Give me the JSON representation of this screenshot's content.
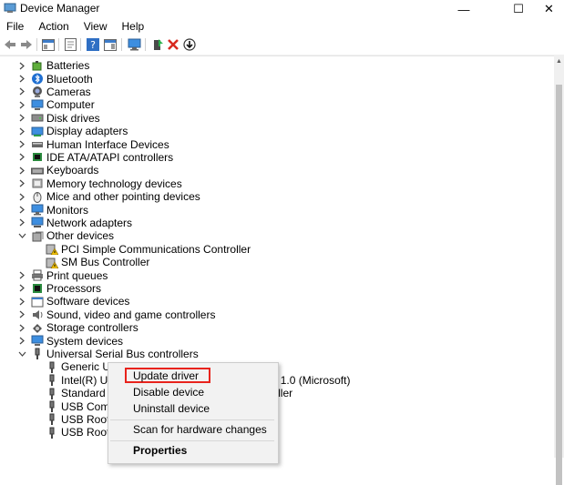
{
  "window": {
    "title": "Device Manager",
    "minimize": "—",
    "maximize": "☐",
    "close": "✕"
  },
  "menu": [
    "File",
    "Action",
    "View",
    "Help"
  ],
  "tree": [
    {
      "label": "Batteries",
      "expanded": false,
      "icon": "battery-icon"
    },
    {
      "label": "Bluetooth",
      "expanded": false,
      "icon": "bluetooth-icon"
    },
    {
      "label": "Cameras",
      "expanded": false,
      "icon": "camera-icon"
    },
    {
      "label": "Computer",
      "expanded": false,
      "icon": "computer-icon"
    },
    {
      "label": "Disk drives",
      "expanded": false,
      "icon": "disk-drive-icon"
    },
    {
      "label": "Display adapters",
      "expanded": false,
      "icon": "display-adapter-icon"
    },
    {
      "label": "Human Interface Devices",
      "expanded": false,
      "icon": "hid-icon"
    },
    {
      "label": "IDE ATA/ATAPI controllers",
      "expanded": false,
      "icon": "ide-controller-icon"
    },
    {
      "label": "Keyboards",
      "expanded": false,
      "icon": "keyboard-icon"
    },
    {
      "label": "Memory technology devices",
      "expanded": false,
      "icon": "memory-icon"
    },
    {
      "label": "Mice and other pointing devices",
      "expanded": false,
      "icon": "mouse-icon"
    },
    {
      "label": "Monitors",
      "expanded": false,
      "icon": "monitor-icon"
    },
    {
      "label": "Network adapters",
      "expanded": false,
      "icon": "network-adapter-icon"
    },
    {
      "label": "Other devices",
      "expanded": true,
      "icon": "other-devices-icon"
    },
    {
      "label": "PCI Simple Communications Controller",
      "child": true,
      "icon": "warning-device-icon"
    },
    {
      "label": "SM Bus Controller",
      "child": true,
      "icon": "warning-device-icon"
    },
    {
      "label": "Print queues",
      "expanded": false,
      "icon": "printer-icon"
    },
    {
      "label": "Processors",
      "expanded": false,
      "icon": "processor-icon"
    },
    {
      "label": "Software devices",
      "expanded": false,
      "icon": "software-device-icon"
    },
    {
      "label": "Sound, video and game controllers",
      "expanded": false,
      "icon": "sound-icon"
    },
    {
      "label": "Storage controllers",
      "expanded": false,
      "icon": "storage-controller-icon"
    },
    {
      "label": "System devices",
      "expanded": false,
      "icon": "system-device-icon"
    },
    {
      "label": "Universal Serial Bus controllers",
      "expanded": true,
      "icon": "usb-controller-icon"
    },
    {
      "label": "Generic USB Hub",
      "child": true,
      "icon": "usb-plug-icon"
    },
    {
      "label": "Intel(R) USB 3.0 eXtensible Host Controller - 1.0 (Microsoft)",
      "child": true,
      "icon": "usb-plug-icon"
    },
    {
      "label": "Standard Enhanced PCI to USB Host Controller",
      "child": true,
      "icon": "usb-plug-icon"
    },
    {
      "label": "USB Composite Device",
      "child": true,
      "icon": "usb-plug-icon"
    },
    {
      "label": "USB Root Hub",
      "child": true,
      "icon": "usb-plug-icon"
    },
    {
      "label": "USB Root Hub (USB 3.0)",
      "child": true,
      "icon": "usb-plug-icon"
    }
  ],
  "context_menu": {
    "update": "Update driver",
    "disable": "Disable device",
    "uninstall": "Uninstall device",
    "scan": "Scan for hardware changes",
    "properties": "Properties",
    "highlight_color": "#e8231c"
  }
}
